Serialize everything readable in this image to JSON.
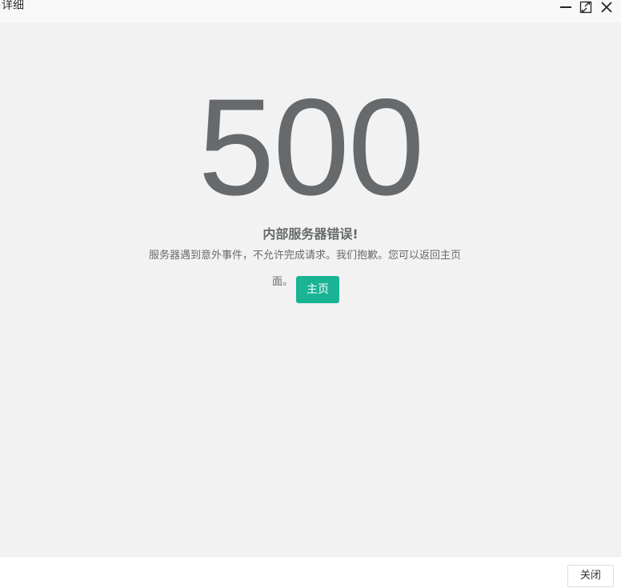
{
  "window": {
    "title": "详细",
    "controls": {
      "minimize_icon": "minimize-icon",
      "maximize_icon": "maximize-icon",
      "close_icon": "close-icon"
    }
  },
  "error": {
    "code": "500",
    "title": "内部服务器错误!",
    "description_line1": "服务器遇到意外事件，不允许完成请求。我们抱歉。您可以返回主页",
    "description_line2": "面。",
    "home_button": "主页"
  },
  "footer": {
    "close_button": "关闭"
  },
  "colors": {
    "accent": "#1ab394",
    "text": "#676a6c",
    "background": "#f2f2f2"
  }
}
